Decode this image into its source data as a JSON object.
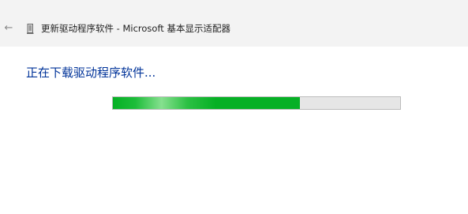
{
  "window": {
    "back_icon": "back-arrow-icon",
    "device_icon": "display-device-icon",
    "title": "更新驱动程序软件 - Microsoft 基本显示适配器"
  },
  "main": {
    "status": "正在下载驱动程序软件...",
    "progress": {
      "fraction": 0.65,
      "fill_color": "#06b025",
      "track_color": "#e6e6e6"
    }
  }
}
